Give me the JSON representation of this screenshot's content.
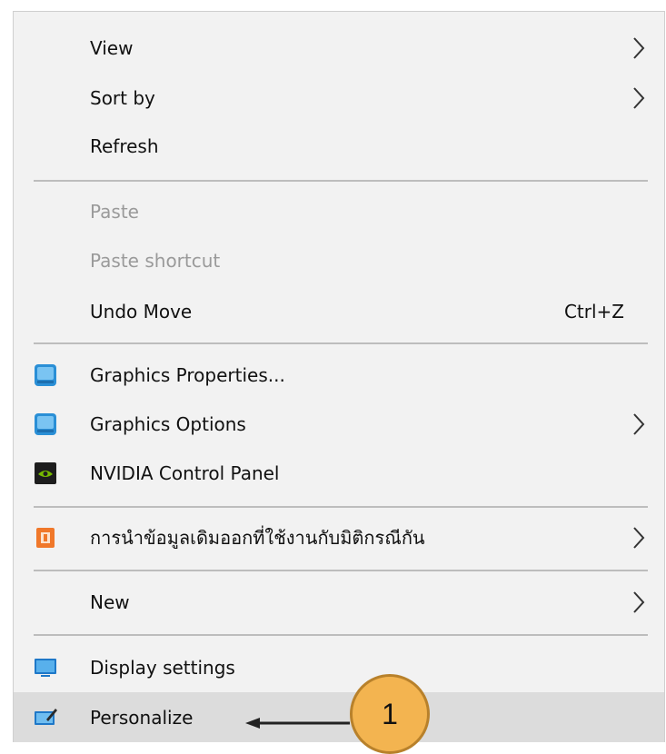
{
  "menu": {
    "items": [
      {
        "label": "View",
        "submenu": true
      },
      {
        "label": "Sort by",
        "submenu": true
      },
      {
        "label": "Refresh"
      },
      {
        "label": "Paste",
        "disabled": true
      },
      {
        "label": "Paste shortcut",
        "disabled": true
      },
      {
        "label": "Undo Move",
        "shortcut": "Ctrl+Z"
      },
      {
        "label": "Graphics Properties...",
        "icon": "intel-graphics-icon"
      },
      {
        "label": "Graphics Options",
        "icon": "intel-graphics-icon",
        "submenu": true
      },
      {
        "label": "NVIDIA Control Panel",
        "icon": "nvidia-icon"
      },
      {
        "label": "การนำข้อมูลเดิมออกที่ใช้งานกับมิติกรณีกัน",
        "icon": "orange-app-icon",
        "submenu": true
      },
      {
        "label": "New",
        "submenu": true
      },
      {
        "label": "Display settings",
        "icon": "display-icon"
      },
      {
        "label": "Personalize",
        "icon": "personalize-icon",
        "highlighted": true
      }
    ]
  },
  "callout": {
    "number": "1"
  },
  "colors": {
    "menu_bg": "#f2f2f2",
    "highlight": "#dcdcdc",
    "callout_fill": "#f3b450",
    "callout_border": "#b8812b"
  }
}
